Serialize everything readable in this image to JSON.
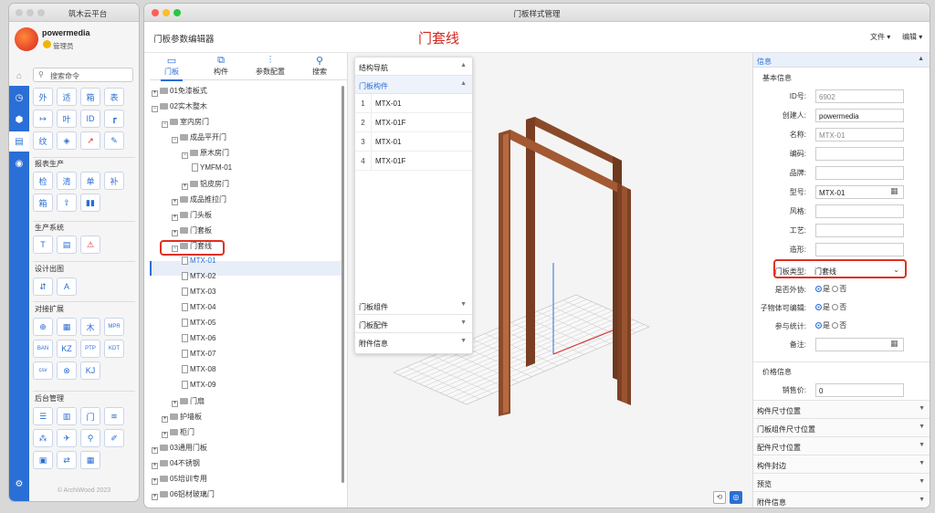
{
  "platform": {
    "title": "筑木云平台",
    "user": {
      "name": "powermedia",
      "role": "管理员"
    },
    "search_placeholder": "搜索命令",
    "row1": [
      "外",
      "适",
      "箱",
      "表"
    ],
    "row2": [
      "↦",
      "叶",
      "ID",
      "┏"
    ],
    "row3": [
      "纹",
      "◈",
      "↗",
      "✎"
    ],
    "section_report": "报表生产",
    "row4": [
      "检",
      "清",
      "单",
      "补"
    ],
    "row5": [
      "箱",
      "⇪",
      "▮▮"
    ],
    "section_gen": "生产系统",
    "row6": [
      "T",
      "▤",
      "⚠"
    ],
    "section_design": "设计出图",
    "row7": [
      "⇵",
      "A"
    ],
    "section_ext": "对接扩展",
    "row8": [
      "⊕",
      "▦",
      "木",
      "MPR"
    ],
    "row9": [
      "BAN",
      "KZ",
      "PTP",
      "KDT"
    ],
    "row10": [
      "csv",
      "⊗",
      "KJ"
    ],
    "section_admin": "后台管理",
    "row11": [
      "☰",
      "▥",
      "门",
      "≋"
    ],
    "row12": [
      "⁂",
      "✈",
      "⚲",
      "✐"
    ],
    "row13": [
      "▣",
      "⇄",
      "▦"
    ],
    "copyright": "© ArchiWood 2023"
  },
  "main": {
    "window_title": "门板样式管理",
    "app_title": "门板参数编辑器",
    "big_title": "门套线",
    "menu_file": "文件 ▾",
    "menu_edit": "编辑 ▾",
    "tabs": [
      {
        "label": "门板",
        "icon": "▭"
      },
      {
        "label": "构件",
        "icon": "⧉"
      },
      {
        "label": "参数配置",
        "icon": "⫶"
      },
      {
        "label": "搜索",
        "icon": "⚲"
      }
    ],
    "tree": [
      {
        "label": "01免漆板式",
        "toggle": "+",
        "type": "folder",
        "level": 0
      },
      {
        "label": "02实木整木",
        "toggle": "−",
        "type": "folder",
        "level": 0
      },
      {
        "label": "室内房门",
        "toggle": "−",
        "type": "folder",
        "level": 1
      },
      {
        "label": "成品平开门",
        "toggle": "−",
        "type": "folder",
        "level": 2
      },
      {
        "label": "原木房门",
        "toggle": "−",
        "type": "folder",
        "level": 3
      },
      {
        "label": "YMFM-01",
        "toggle": "",
        "type": "file",
        "level": 4
      },
      {
        "label": "铝皮房门",
        "toggle": "+",
        "type": "folder",
        "level": 3
      },
      {
        "label": "成品推拉门",
        "toggle": "+",
        "type": "folder",
        "level": 2
      },
      {
        "label": "门头板",
        "toggle": "+",
        "type": "folder",
        "level": 2
      },
      {
        "label": "门套板",
        "toggle": "+",
        "type": "folder",
        "level": 2
      },
      {
        "label": "门套线",
        "toggle": "−",
        "type": "folder",
        "level": 2
      },
      {
        "label": "MTX-01",
        "toggle": "",
        "type": "file",
        "level": 3,
        "selected": true
      },
      {
        "label": "MTX-02",
        "toggle": "",
        "type": "file",
        "level": 3
      },
      {
        "label": "MTX-03",
        "toggle": "",
        "type": "file",
        "level": 3
      },
      {
        "label": "MTX-04",
        "toggle": "",
        "type": "file",
        "level": 3
      },
      {
        "label": "MTX-05",
        "toggle": "",
        "type": "file",
        "level": 3
      },
      {
        "label": "MTX-06",
        "toggle": "",
        "type": "file",
        "level": 3
      },
      {
        "label": "MTX-07",
        "toggle": "",
        "type": "file",
        "level": 3
      },
      {
        "label": "MTX-08",
        "toggle": "",
        "type": "file",
        "level": 3
      },
      {
        "label": "MTX-09",
        "toggle": "",
        "type": "file",
        "level": 3
      },
      {
        "label": "门扇",
        "toggle": "+",
        "type": "folder",
        "level": 2
      },
      {
        "label": "护墙板",
        "toggle": "+",
        "type": "folder",
        "level": 1
      },
      {
        "label": "柜门",
        "toggle": "+",
        "type": "folder",
        "level": 1
      },
      {
        "label": "03通用门板",
        "toggle": "+",
        "type": "folder",
        "level": 0
      },
      {
        "label": "04不锈钢",
        "toggle": "+",
        "type": "folder",
        "level": 0
      },
      {
        "label": "05培训专用",
        "toggle": "+",
        "type": "folder",
        "level": 0
      },
      {
        "label": "06铝材玻璃门",
        "toggle": "+",
        "type": "folder",
        "level": 0
      }
    ],
    "nav": {
      "header": "结构导航",
      "sub_header": "门板构件",
      "items": [
        {
          "index": "1",
          "name": "MTX-01"
        },
        {
          "index": "2",
          "name": "MTX-01F"
        },
        {
          "index": "3",
          "name": "MTX-01"
        },
        {
          "index": "4",
          "name": "MTX-01F"
        }
      ],
      "footer": [
        "门板组件",
        "门板配件",
        "附件信息"
      ]
    },
    "info": {
      "header": "信息",
      "group_basic": "基本信息",
      "fields": [
        {
          "label": "ID号:",
          "value": "6902",
          "gray": true
        },
        {
          "label": "创建人:",
          "value": "powermedia"
        },
        {
          "label": "名称:",
          "value": "MTX-01",
          "gray": true
        },
        {
          "label": "编码:",
          "value": ""
        },
        {
          "label": "品牌:",
          "value": ""
        },
        {
          "label": "型号:",
          "value": "MTX-01"
        },
        {
          "label": "风格:",
          "value": ""
        },
        {
          "label": "工艺:",
          "value": ""
        },
        {
          "label": "造形:",
          "value": ""
        }
      ],
      "door_type_label": "门板类型:",
      "door_type_value": "门套线",
      "radios": [
        {
          "label": "是否外协:",
          "yes": "是",
          "no": "否"
        },
        {
          "label": "子物体可编辑:",
          "yes": "是",
          "no": "否"
        },
        {
          "label": "参与统计:",
          "yes": "是",
          "no": "否"
        }
      ],
      "remark_label": "备注:",
      "group_price": "价格信息",
      "price_label": "销售价:",
      "price_value": "0",
      "accordions": [
        "构件尺寸位置",
        "门板组件尺寸位置",
        "配件尺寸位置",
        "构件封边",
        "预览",
        "附件信息"
      ]
    }
  }
}
